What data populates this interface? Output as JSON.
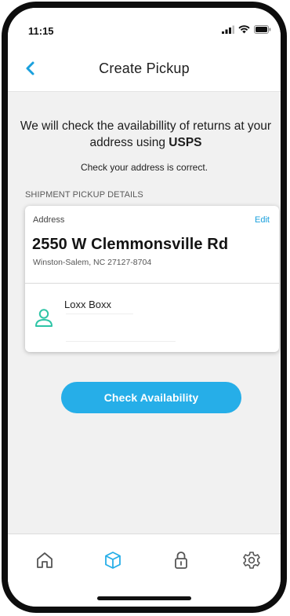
{
  "status_bar": {
    "time": "11:15"
  },
  "header": {
    "title": "Create Pickup"
  },
  "intro": {
    "text_before": "We will check the availabillity of returns at your address using ",
    "carrier": "USPS",
    "note": "Check your address is correct."
  },
  "section": {
    "label": "SHIPMENT PICKUP DETAILS"
  },
  "address_card": {
    "label": "Address",
    "edit_label": "Edit",
    "street": "2550 W Clemmonsville Rd",
    "city_line": "Winston-Salem, NC 27127-8704",
    "locker_name": "Loxx Boxx"
  },
  "actions": {
    "check_label": "Check Availability"
  },
  "tab_bar": {
    "tabs": [
      {
        "icon": "home-icon",
        "active": false
      },
      {
        "icon": "package-icon",
        "active": true
      },
      {
        "icon": "lock-icon",
        "active": false
      },
      {
        "icon": "gear-icon",
        "active": false
      }
    ]
  },
  "colors": {
    "accent": "#26aee8",
    "link": "#1aa0dd",
    "locker_icon": "#2ec4a6"
  }
}
